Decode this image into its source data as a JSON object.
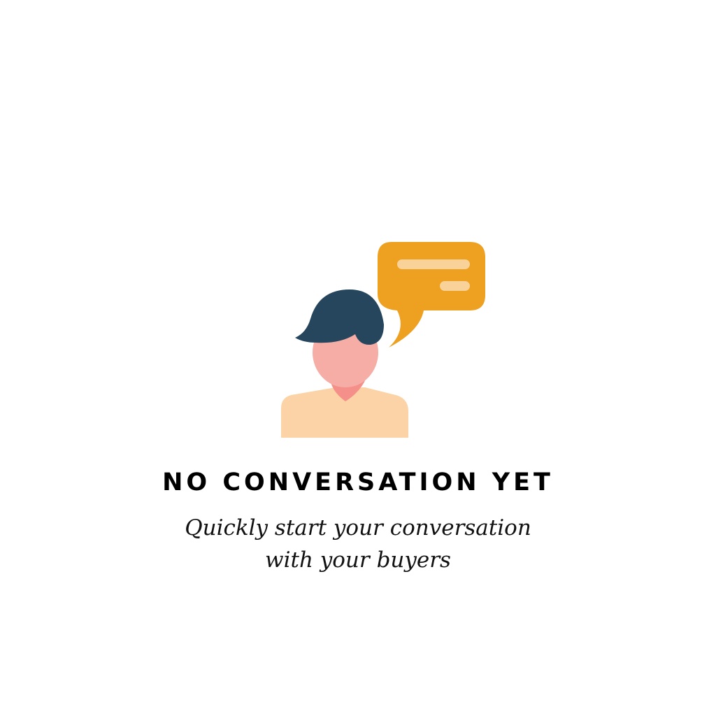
{
  "empty_state": {
    "illustration_icon": "person-chat-bubble-icon",
    "title": "NO CONVERSATION YET",
    "subtitle_line1": "Quickly start your conversation",
    "subtitle_line2": "with your buyers"
  },
  "colors": {
    "bubble": "#EEA021",
    "bubble_lines": "#F9D29A",
    "hair": "#26465E",
    "face": "#F6ADA6",
    "neck": "#F49089",
    "shirt": "#FBD3A6"
  }
}
